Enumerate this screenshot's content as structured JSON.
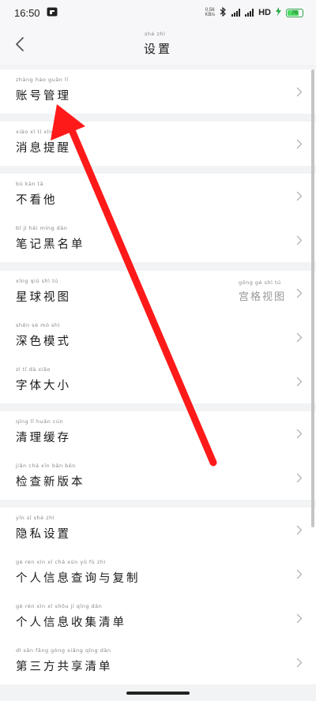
{
  "status_bar": {
    "time": "16:50",
    "net_speed_value": "0.56",
    "net_speed_unit": "KB/s",
    "network_type": "HD",
    "battery_level": "76"
  },
  "nav": {
    "title": "设置",
    "title_pinyin": "shè zhì"
  },
  "groups": [
    {
      "items": [
        {
          "label": "账号管理",
          "pinyin": "zhàng hào guǎn lǐ"
        }
      ]
    },
    {
      "items": [
        {
          "label": "消息提醒",
          "pinyin": "xiāo xī tí xǐng"
        }
      ]
    },
    {
      "items": [
        {
          "label": "不看他",
          "pinyin": "bù kàn tā"
        },
        {
          "label": "笔记黑名单",
          "pinyin": "bǐ jì hēi míng dān"
        }
      ]
    },
    {
      "items": [
        {
          "label": "星球视图",
          "pinyin": "xīng qiú shì tú",
          "value": "宫格视图",
          "value_pinyin": "gōng gé shì tú"
        },
        {
          "label": "深色模式",
          "pinyin": "shēn sè mó shì"
        },
        {
          "label": "字体大小",
          "pinyin": "zì tǐ dà xiǎo"
        }
      ]
    },
    {
      "items": [
        {
          "label": "清理缓存",
          "pinyin": "qīng lǐ huǎn cún"
        },
        {
          "label": "检查新版本",
          "pinyin": "jiǎn chá xīn bǎn běn"
        }
      ]
    },
    {
      "items": [
        {
          "label": "隐私设置",
          "pinyin": "yǐn sī shè zhì"
        },
        {
          "label": "个人信息查询与复制",
          "pinyin": "gè rén xìn xī chá xún yǔ fù zhì"
        },
        {
          "label": "个人信息收集清单",
          "pinyin": "gè rén xìn xī shōu jí qīng dān"
        },
        {
          "label": "第三方共享清单",
          "pinyin": "dì sān fāng gòng xiǎng qīng dān"
        }
      ]
    }
  ],
  "colors": {
    "arrow": "#ff1a1a",
    "background": "#f2f3f5",
    "battery": "#4cd964"
  },
  "icons": {
    "back": "chevron-left-icon",
    "row_arrow": "chevron-right-icon",
    "annotation": "red-arrow-annotation"
  }
}
